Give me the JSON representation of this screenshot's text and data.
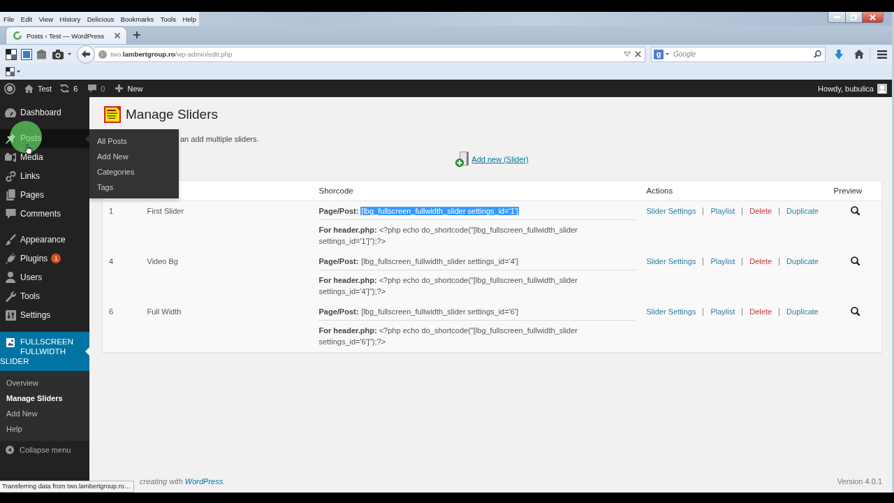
{
  "browser": {
    "menu": [
      "File",
      "Edit",
      "View",
      "History",
      "Delicious",
      "Bookmarks",
      "Tools",
      "Help"
    ],
    "tabs": [
      {
        "title": "Posts ‹ Test — WordPress",
        "selected": true,
        "loading": true
      }
    ],
    "address": "two.**lambertgroup.ro**/wp-admin/edit.php",
    "search": {
      "engine_letter": "g",
      "placeholder": "Google"
    },
    "status": "Transferring data from two.lambertgroup.ro…"
  },
  "admin_bar": {
    "site_name": "Test",
    "updates_count": "6",
    "comments_count": "0",
    "new_label": "New",
    "greeting": "Howdy, bubulica"
  },
  "sidebar": {
    "groups": [
      {
        "items": [
          {
            "label": "Dashboard",
            "selected": false,
            "hovered": false
          }
        ]
      },
      {
        "items": [
          {
            "label": "Posts",
            "selected": false,
            "hovered": true,
            "submenu": [
              {
                "label": "All Posts",
                "selected": false
              },
              {
                "label": "Add New",
                "selected": false
              },
              {
                "label": "Categories",
                "selected": false
              },
              {
                "label": "Tags",
                "selected": false
              }
            ]
          },
          {
            "label": "Media",
            "selected": false,
            "hovered": false
          },
          {
            "label": "Links",
            "selected": false,
            "hovered": false
          },
          {
            "label": "Pages",
            "selected": false,
            "hovered": false
          },
          {
            "label": "Comments",
            "selected": false,
            "hovered": false
          }
        ]
      },
      {
        "items": [
          {
            "label": "Appearance",
            "selected": false,
            "hovered": false
          },
          {
            "label": "Plugins",
            "selected": false,
            "hovered": false,
            "badge": "1"
          },
          {
            "label": "Users",
            "selected": false,
            "hovered": false
          },
          {
            "label": "Tools",
            "selected": false,
            "hovered": false
          },
          {
            "label": "Settings",
            "selected": false,
            "hovered": false
          }
        ]
      },
      {
        "items": [
          {
            "label": "FULLSCREEN FULLWIDTH SLIDER",
            "selected": true,
            "hovered": false,
            "submenu": [
              {
                "label": "Overview",
                "selected": false
              },
              {
                "label": "Manage Sliders",
                "selected": true
              },
              {
                "label": "Add New",
                "selected": false
              },
              {
                "label": "Help",
                "selected": false
              }
            ]
          }
        ]
      }
    ],
    "collapse": "Collapse menu"
  },
  "page": {
    "title": "Manage Sliders",
    "description": "an add multiple sliders.",
    "add_new": "Add new (Slider)"
  },
  "table": {
    "columns": [
      {
        "label": "Shorcode"
      },
      {
        "label": "Actions"
      },
      {
        "label": "Preview"
      }
    ],
    "rows": [
      {
        "id": "1",
        "name": "First Slider",
        "page_post_label": "Page/Post:",
        "shortcode": "[lbg_fullscreen_fullwidth_slider settings_id='1']",
        "shortcode_selected": true,
        "header_code": "**For header.php:** <?php echo do_shortcode(\"[lbg_fullscreen_fullwidth_slider settings_id='1']\");?>",
        "actions": [
          {
            "label": "Slider Settings",
            "kind": "link"
          },
          {
            "label": "Playlist",
            "kind": "link"
          },
          {
            "label": "Delete",
            "kind": "danger"
          },
          {
            "label": "Duplicate",
            "kind": "link"
          }
        ]
      },
      {
        "id": "4",
        "name": "Video Bg",
        "page_post_label": "Page/Post:",
        "shortcode": "[lbg_fullscreen_fullwidth_slider settings_id='4']",
        "shortcode_selected": false,
        "header_code": "**For header.php:** <?php echo do_shortcode(\"[lbg_fullscreen_fullwidth_slider settings_id='4']\");?>",
        "actions": [
          {
            "label": "Slider Settings",
            "kind": "link"
          },
          {
            "label": "Playlist",
            "kind": "link"
          },
          {
            "label": "Delete",
            "kind": "danger"
          },
          {
            "label": "Duplicate",
            "kind": "link"
          }
        ]
      },
      {
        "id": "6",
        "name": "Full Width",
        "page_post_label": "Page/Post:",
        "shortcode": "[lbg_fullscreen_fullwidth_slider settings_id='6']",
        "shortcode_selected": false,
        "header_code": "**For header.php:** <?php echo do_shortcode(\"[lbg_fullscreen_fullwidth_slider settings_id='6']\");?>",
        "actions": [
          {
            "label": "Slider Settings",
            "kind": "link"
          },
          {
            "label": "Playlist",
            "kind": "link"
          },
          {
            "label": "Delete",
            "kind": "danger"
          },
          {
            "label": "Duplicate",
            "kind": "link"
          }
        ]
      }
    ]
  },
  "footer": {
    "credit_before": "creating with ",
    "credit_link": "WordPress",
    "credit_after": ".",
    "version": "Version 4.0.1"
  }
}
